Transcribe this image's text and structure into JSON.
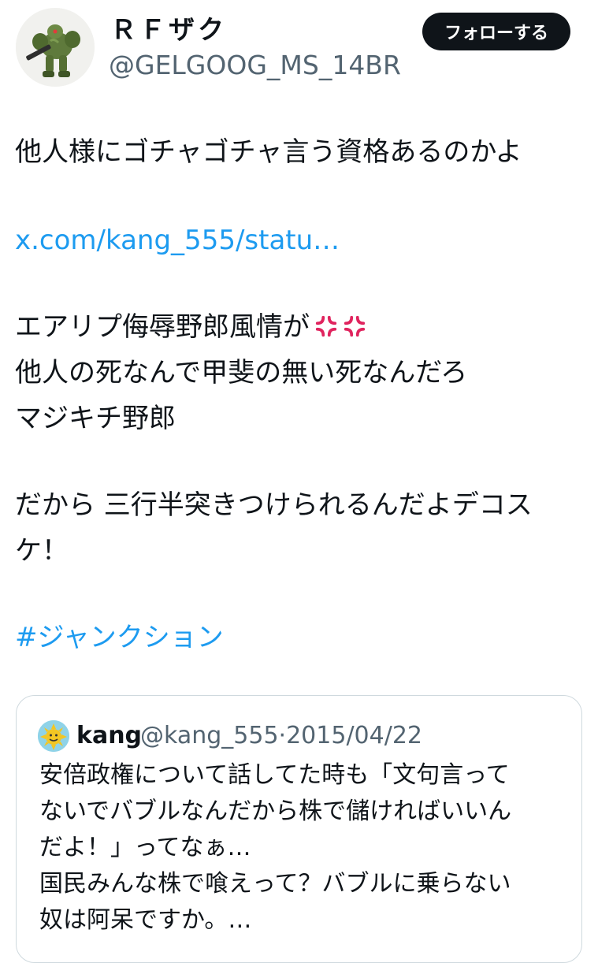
{
  "author": {
    "display_name": "ＲＦザク",
    "handle": "@GELGOOG_MS_14BR",
    "avatar_icon": "green-mobile-suit-figure-avatar"
  },
  "follow_button": {
    "label": "フォローする"
  },
  "tweet": {
    "line1": "他人様にゴチャゴチャ言う資格あるのかよ",
    "link": "x.com/kang_555/statu…",
    "line3": "エアリプ侮辱野郎風情が",
    "emoji": [
      "anger-symbol-icon",
      "anger-symbol-icon"
    ],
    "line4": "他人の死なんで甲斐の無い死なんだろ",
    "line5": "マジキチ野郎",
    "line6": "だから 三行半突きつけられるんだよデコス",
    "line7": "ケ！",
    "hashtag": "#ジャンクション"
  },
  "quote": {
    "name": "kang",
    "handle": "@kang_555",
    "separator": "·",
    "date": "2015/04/22",
    "lines": [
      "安倍政権について話してた時も「文句言って",
      "ないでバブルなんだから株で儲ければいいん",
      "だよ！」ってなぁ…",
      "国民みんな株で喰えって？バブルに乗らない",
      "奴は阿呆ですか。…"
    ]
  },
  "colors": {
    "text": "#0f1419",
    "secondary": "#536471",
    "link": "#1d9bf0",
    "follow_bg": "#0f1419",
    "anger": "#e0245e"
  }
}
